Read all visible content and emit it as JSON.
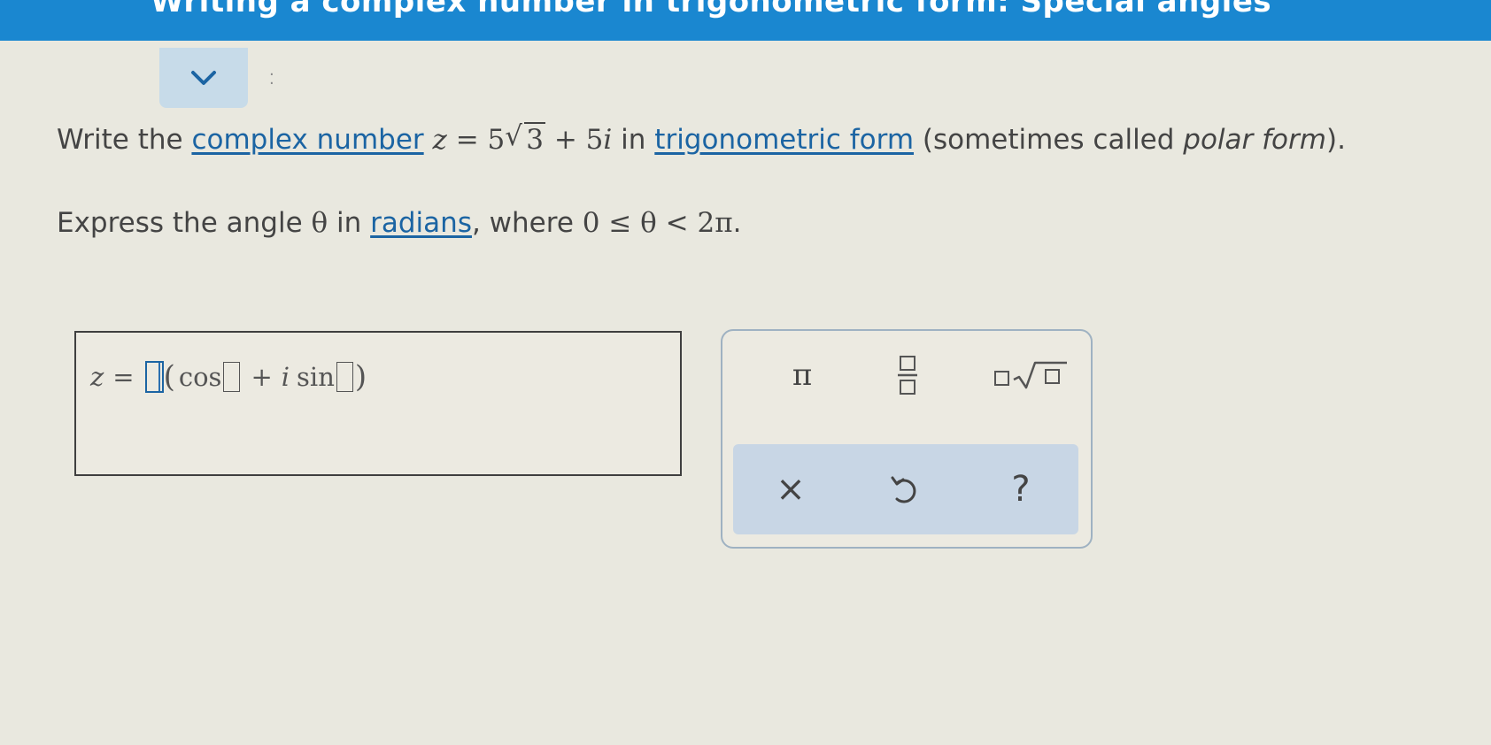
{
  "header": {
    "title": "Writing a complex number in trigonometric form: Special angles"
  },
  "question": {
    "line1_before": "Write the ",
    "link_complex_number": "complex number",
    "expr_z": "z",
    "expr_eq": " = 5",
    "expr_radicand": "3",
    "expr_plus": " + 5",
    "expr_i": "i",
    "line1_mid": " in ",
    "link_trig_form": "trigonometric form",
    "line1_after": " (sometimes called ",
    "polar_form": "polar form",
    "line1_end": ").",
    "line2_before": "Express the angle ",
    "theta": "θ",
    "line2_mid": " in ",
    "link_radians": "radians",
    "line2_after": ", where ",
    "condition": "0 ≤ θ < 2π",
    "line2_end": "."
  },
  "answer": {
    "z": "z",
    "equals": "=",
    "open_paren": "(",
    "cos": "cos",
    "plus": "+",
    "i": "i",
    "sin": "sin",
    "close_paren": ")"
  },
  "tools": {
    "pi": "π",
    "clear": "×",
    "help": "?"
  },
  "colors": {
    "header_bg": "#1a87d0",
    "link": "#1b64a3",
    "tool_row_bg": "#c8d6e5",
    "panel_border": "#9fb2c2"
  }
}
